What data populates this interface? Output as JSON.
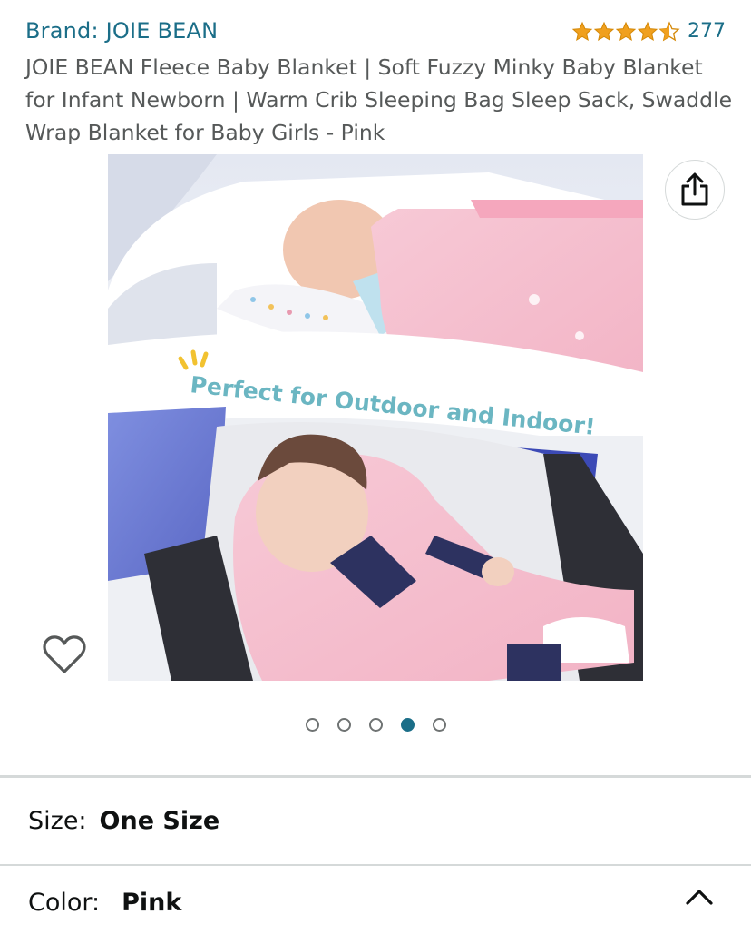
{
  "product": {
    "brand": "Brand: JOIE BEAN",
    "rating_count": "277",
    "rating_value": 4.5,
    "title": "JOIE BEAN Fleece Baby Blanket | Soft Fuzzy Minky Baby Blanket for Infant Newborn | Warm Crib Sleeping Bag Sleep Sack, Swaddle Wrap Blanket for Baby Girls - Pink"
  },
  "image": {
    "banner_text": "Perfect for Outdoor and Indoor!",
    "page_count": 5,
    "current_page": 4
  },
  "options": {
    "size_label": "Size:",
    "size_value": "One Size",
    "color_label": "Color:",
    "color_value": "Pink"
  },
  "icons": {
    "share": "share-icon",
    "wishlist": "heart-icon",
    "collapse": "chevron-up-icon",
    "star": "star-icon"
  },
  "colors": {
    "link": "#1b6e88",
    "star": "#f0a01e",
    "text_secondary": "#565959",
    "text_primary": "#0f1111"
  }
}
